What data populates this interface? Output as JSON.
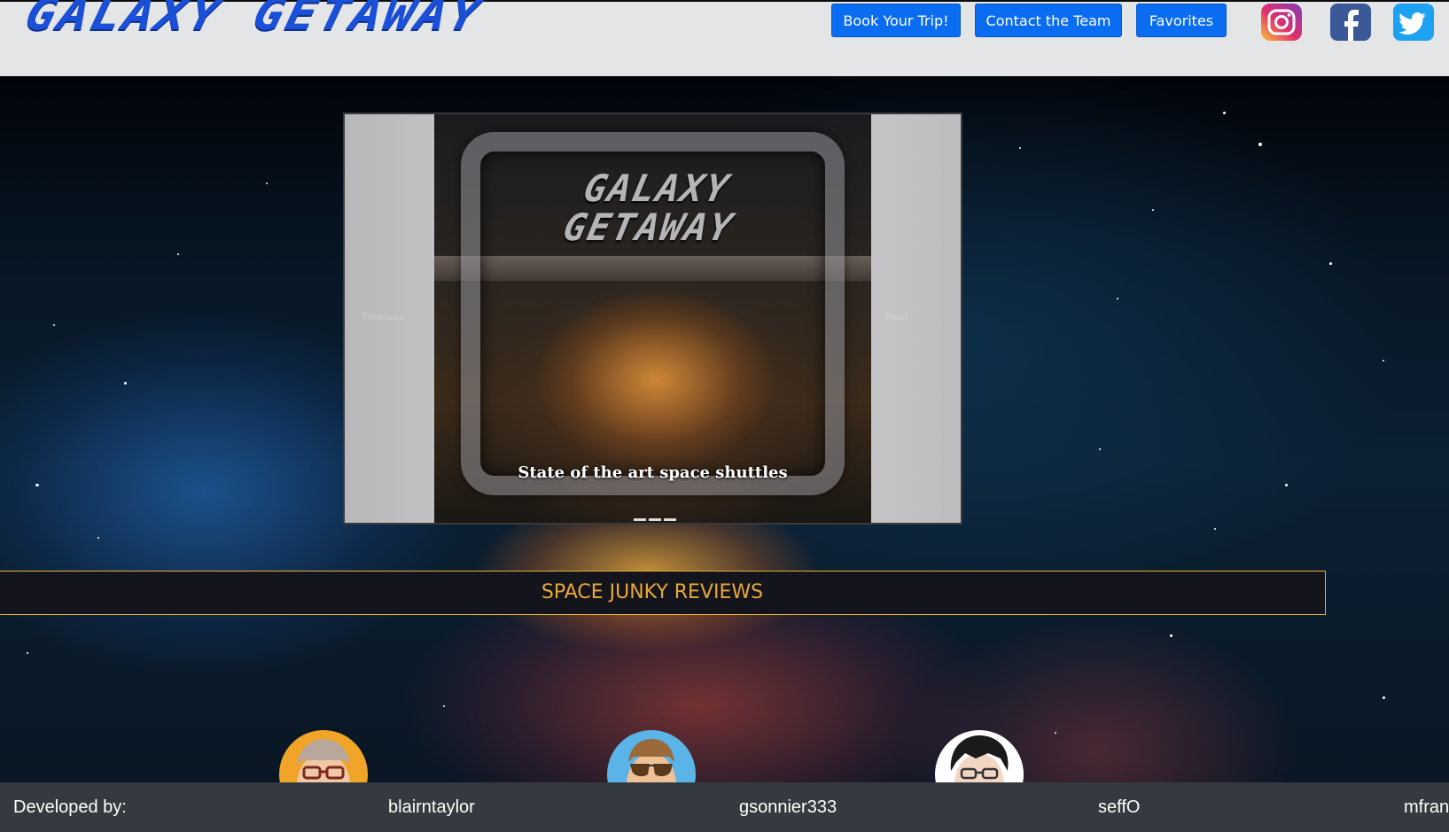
{
  "header": {
    "brand": "GALAXY GETAWAY",
    "nav": [
      {
        "label": "Book Your Trip!"
      },
      {
        "label": "Contact the Team"
      },
      {
        "label": "Favorites"
      }
    ],
    "social": [
      "instagram-icon",
      "facebook-icon",
      "twitter-icon"
    ]
  },
  "carousel": {
    "logo_line1": "GALAXY",
    "logo_line2": "GETAWAY",
    "caption": "State of the art space shuttles",
    "prev_label": "Previous",
    "next_label": "Next",
    "slide_count": 3
  },
  "reviews": {
    "title": "SPACE JUNKY REVIEWS"
  },
  "footer": {
    "label": "Developed by:",
    "developers": [
      "blairntaylor",
      "gsonnier333",
      "seffO",
      "mfran"
    ]
  },
  "colors": {
    "brand": "#1a4fd8",
    "nav_button": "#0a6cf0",
    "reviews_accent": "#e7a83a",
    "footer_bg": "#343a40"
  }
}
